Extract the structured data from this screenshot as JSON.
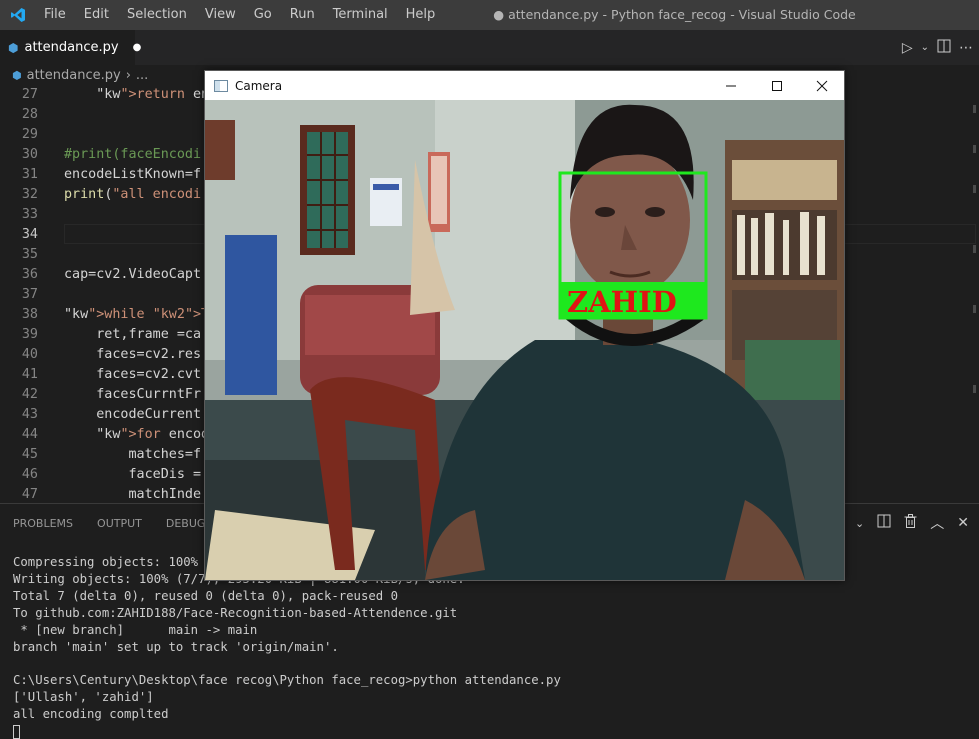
{
  "window": {
    "title": "● attendance.py - Python face_recog - Visual Studio Code",
    "menu": [
      "File",
      "Edit",
      "Selection",
      "View",
      "Go",
      "Run",
      "Terminal",
      "Help"
    ]
  },
  "tab": {
    "label": "attendance.py"
  },
  "breadcrumb": {
    "file": "attendance.py",
    "rest": "..."
  },
  "editor": {
    "lines": [
      {
        "n": "27",
        "code": "    return encode"
      },
      {
        "n": "28",
        "code": ""
      },
      {
        "n": "29",
        "code": ""
      },
      {
        "n": "30",
        "code": "#print(faceEncodi"
      },
      {
        "n": "31",
        "code": "encodeListKnown=f"
      },
      {
        "n": "32",
        "code": "print(\"all encodi"
      },
      {
        "n": "33",
        "code": ""
      },
      {
        "n": "34",
        "code": ""
      },
      {
        "n": "35",
        "code": ""
      },
      {
        "n": "36",
        "code": "cap=cv2.VideoCapt"
      },
      {
        "n": "37",
        "code": ""
      },
      {
        "n": "38",
        "code": "while True:"
      },
      {
        "n": "39",
        "code": "    ret,frame =ca"
      },
      {
        "n": "40",
        "code": "    faces=cv2.res"
      },
      {
        "n": "41",
        "code": "    faces=cv2.cvt"
      },
      {
        "n": "42",
        "code": "    facesCurrntFr"
      },
      {
        "n": "43",
        "code": "    encodeCurrent"
      },
      {
        "n": "44",
        "code": "    for encodeFac"
      },
      {
        "n": "45",
        "code": "        matches=f"
      },
      {
        "n": "46",
        "code": "        faceDis ="
      },
      {
        "n": "47",
        "code": "        matchInde"
      }
    ]
  },
  "panel": {
    "tabs": [
      "PROBLEMS",
      "OUTPUT",
      "DEBUG CO"
    ],
    "terminal": [
      "Compressing objects: 100% (",
      "Writing objects: 100% (7/7), 295.20 KiB | 881.00 KiB/s, done.",
      "Total 7 (delta 0), reused 0 (delta 0), pack-reused 0",
      "To github.com:ZAHID188/Face-Recognition-based-Attendence.git",
      " * [new branch]      main -> main",
      "branch 'main' set up to track 'origin/main'.",
      "",
      "C:\\Users\\Century\\Desktop\\face recog\\Python face_recog>python attendance.py",
      "['Ullash', 'zahid']",
      "all encoding complted"
    ]
  },
  "camera": {
    "title": "Camera",
    "label": "ZAHID",
    "box_color": "#1ee81e",
    "label_color": "#e01414"
  }
}
